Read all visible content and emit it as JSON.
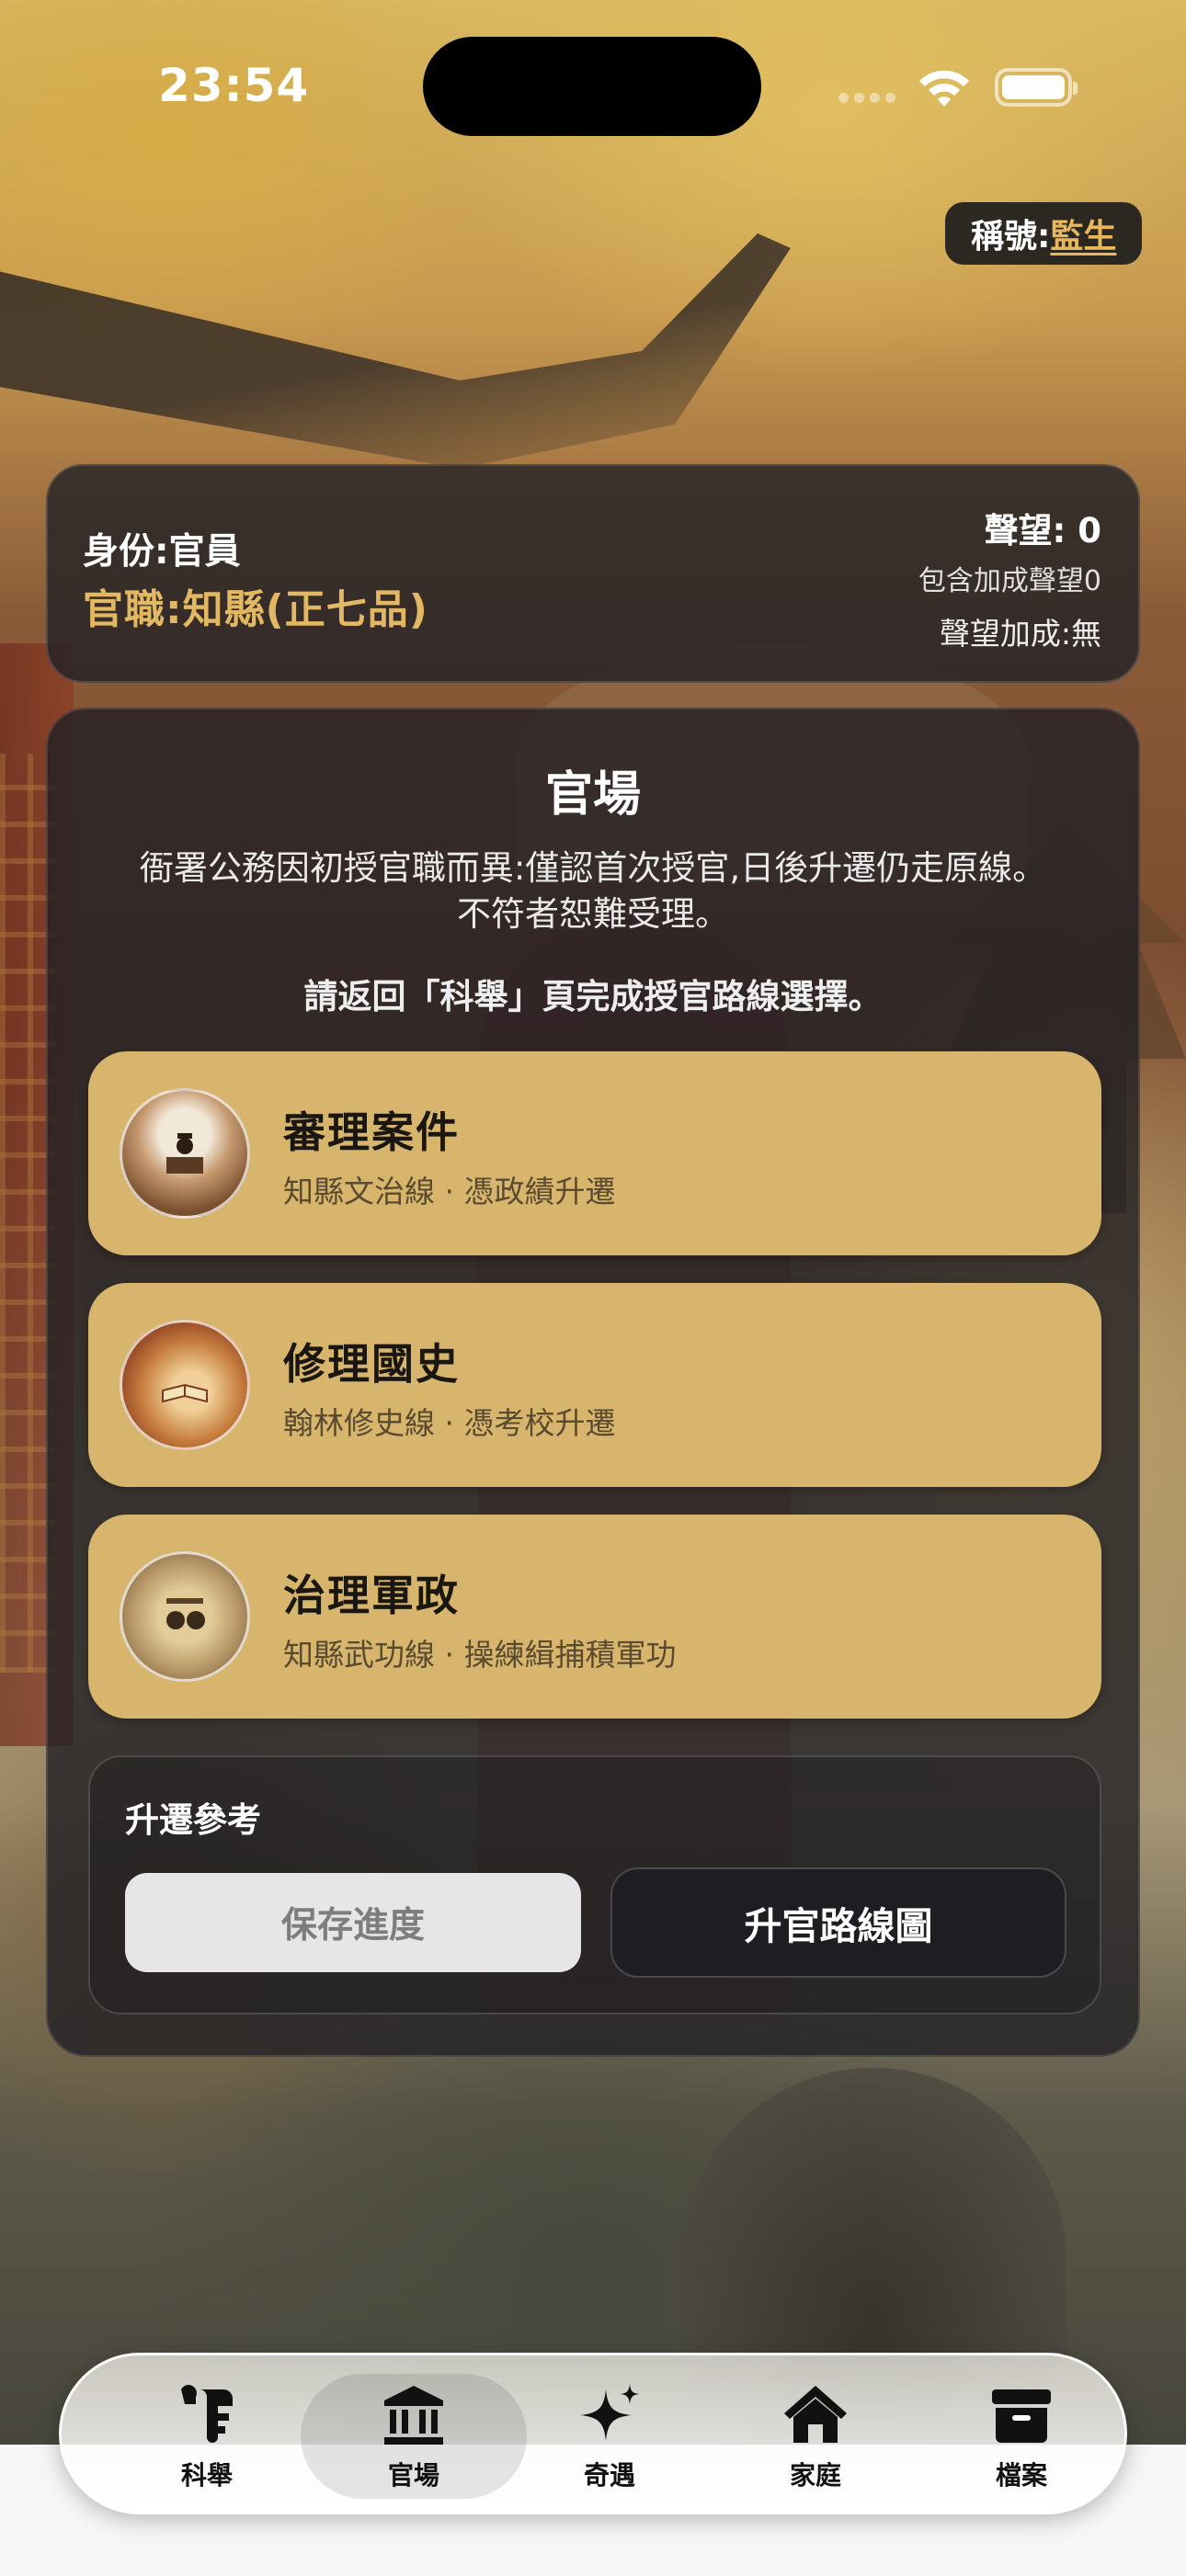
{
  "status_bar": {
    "time": "23:54"
  },
  "title_badge": {
    "label": "稱號:",
    "value": "監生"
  },
  "status": {
    "identity": "身份:官員",
    "post": "官職:知縣(正七品)",
    "reputation": "聲望: 0",
    "reputation_included": "包含加成聲望0",
    "reputation_bonus": "聲望加成:無"
  },
  "officialdom": {
    "title": "官場",
    "description": "衙署公務因初授官職而異:僅認首次授官,日後升遷仍走原線。不符者恕難受理。",
    "note": "請返回「科舉」頁完成授官路線選擇。",
    "routes": [
      {
        "name": "審理案件",
        "desc": "知縣文治線 · 憑政績升遷"
      },
      {
        "name": "修理國史",
        "desc": "翰林修史線 · 憑考校升遷"
      },
      {
        "name": "治理軍政",
        "desc": "知縣武功線 · 操練緝捕積軍功"
      }
    ],
    "reference": {
      "title": "升遷參考",
      "save_label": "保存進度",
      "map_label": "升官路線圖"
    }
  },
  "tabs": [
    {
      "label": "科舉",
      "icon": "scroll-icon"
    },
    {
      "label": "官場",
      "icon": "government-building-icon",
      "active": true
    },
    {
      "label": "奇遇",
      "icon": "sparkles-icon"
    },
    {
      "label": "家庭",
      "icon": "house-icon"
    },
    {
      "label": "檔案",
      "icon": "archive-box-icon"
    }
  ]
}
